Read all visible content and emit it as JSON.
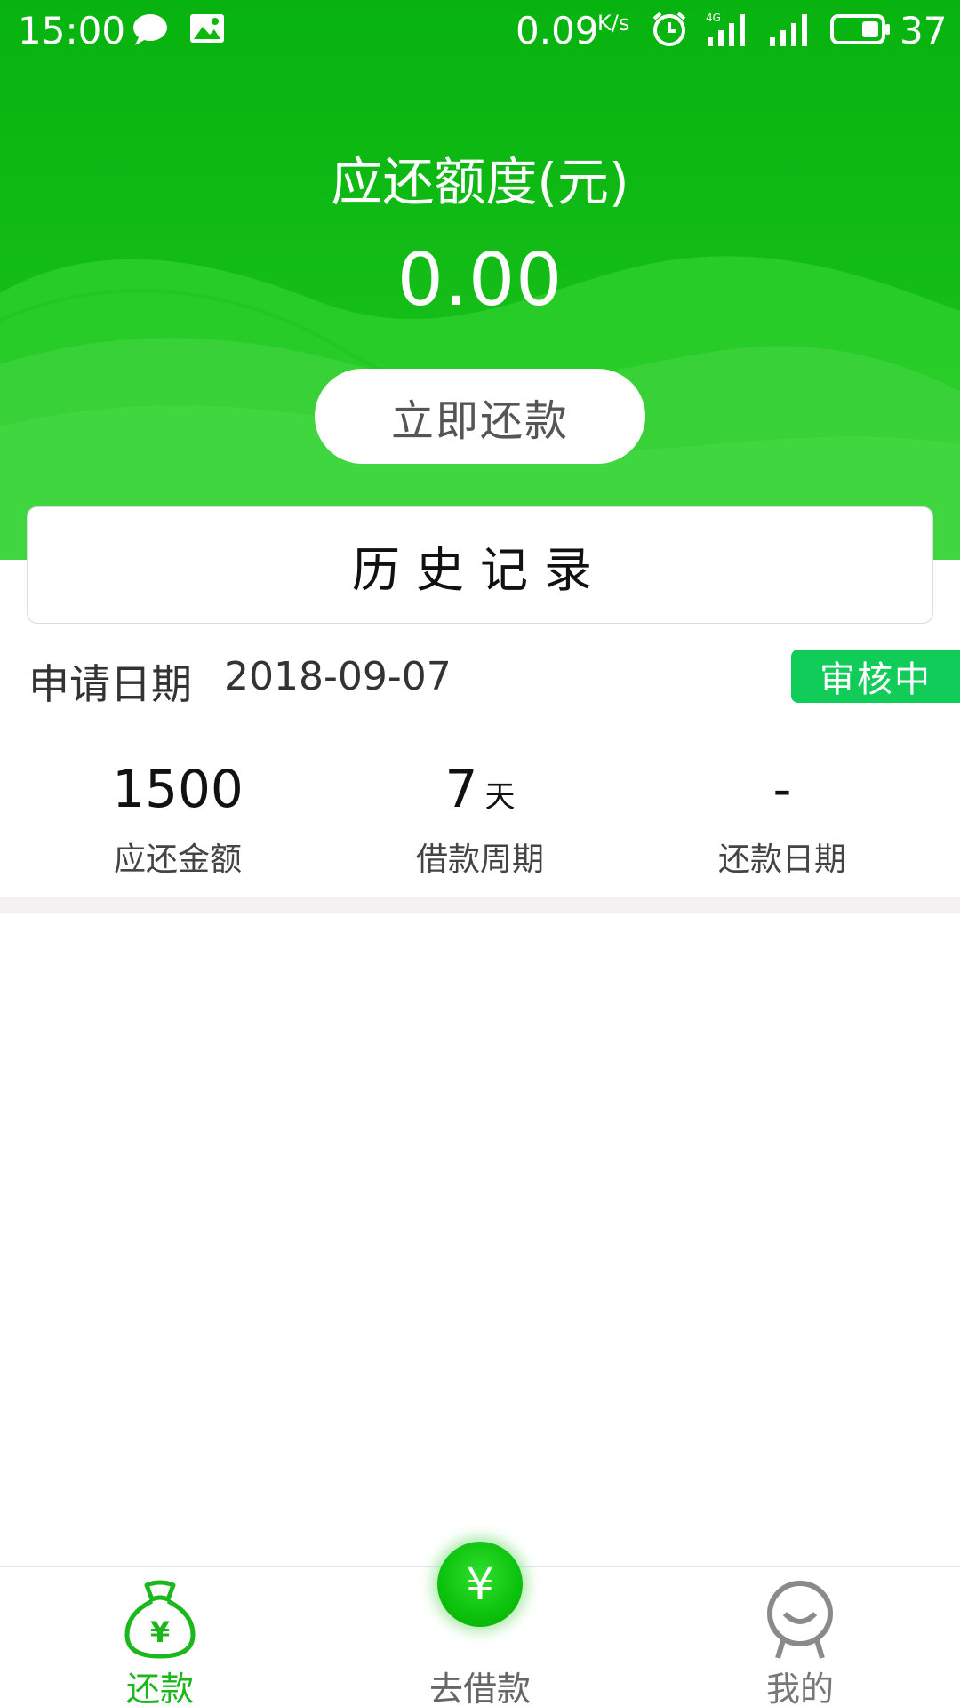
{
  "status_bar": {
    "time": "15:00",
    "speed": "0.09",
    "speed_unit": "K/s",
    "battery": "37",
    "icons": [
      "message-icon",
      "image-icon",
      "alarm-icon",
      "4g-signal-icon",
      "signal-icon",
      "battery-icon"
    ]
  },
  "header": {
    "title": "应还额度(元)",
    "amount": "0.00",
    "repay_button": "立即还款"
  },
  "history": {
    "title": "历史记录"
  },
  "record": {
    "date_label": "申请日期",
    "date_value": "2018-09-07",
    "status": "审核中",
    "stats": [
      {
        "value": "1500",
        "unit": "",
        "label": "应还金额"
      },
      {
        "value": "7",
        "unit": "天",
        "label": "借款周期"
      },
      {
        "value": "-",
        "unit": "",
        "label": "还款日期"
      }
    ]
  },
  "bottom_nav": {
    "items": [
      {
        "label": "还款",
        "icon": "money-bag-icon",
        "active": true
      },
      {
        "label": "去借款",
        "icon": "yen-icon",
        "active": false
      },
      {
        "label": "我的",
        "icon": "user-icon",
        "active": false
      }
    ],
    "fab_symbol": "¥"
  },
  "colors": {
    "primary_green": "#0fb81a",
    "badge_green": "#12cc5a",
    "nav_active": "#1cb71c"
  }
}
